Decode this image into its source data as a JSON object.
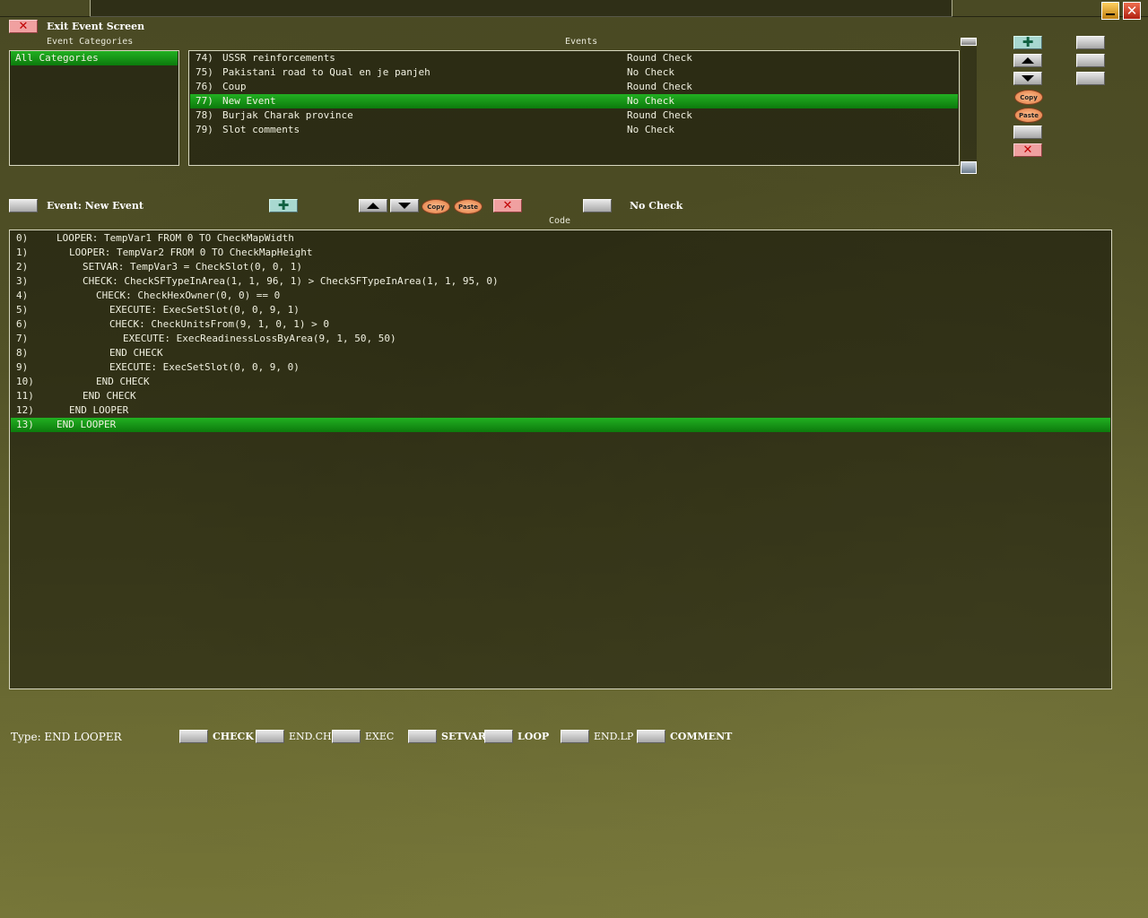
{
  "header": {
    "exit_label": "Exit Event Screen",
    "categories_title": "Event Categories",
    "events_title": "Events",
    "code_title": "Code"
  },
  "categories": [
    "All Categories"
  ],
  "events": [
    {
      "num": "74)",
      "name": "USSR reinforcements",
      "check": "Round Check"
    },
    {
      "num": "75)",
      "name": "Pakistani road to Qual en je panjeh",
      "check": "No Check"
    },
    {
      "num": "76)",
      "name": "Coup",
      "check": "Round Check"
    },
    {
      "num": "77)",
      "name": "New Event",
      "check": "No Check",
      "selected": true
    },
    {
      "num": "78)",
      "name": "Burjak Charak province",
      "check": "Round Check"
    },
    {
      "num": "79)",
      "name": "Slot comments",
      "check": "No Check"
    }
  ],
  "editor": {
    "event_label": "Event: New Event",
    "check_label": "No Check",
    "copy": "Copy",
    "paste": "Paste"
  },
  "code_lines": [
    {
      "n": "0)",
      "indent": 0,
      "text": "LOOPER: TempVar1 FROM 0 TO CheckMapWidth"
    },
    {
      "n": "1)",
      "indent": 1,
      "text": "LOOPER: TempVar2 FROM 0 TO CheckMapHeight"
    },
    {
      "n": "2)",
      "indent": 2,
      "text": "SETVAR: TempVar3 = CheckSlot(0, 0, 1)"
    },
    {
      "n": "3)",
      "indent": 2,
      "text": "CHECK: CheckSFTypeInArea(1, 1, 96, 1) > CheckSFTypeInArea(1, 1, 95, 0)"
    },
    {
      "n": "4)",
      "indent": 3,
      "text": "CHECK: CheckHexOwner(0, 0) == 0"
    },
    {
      "n": "5)",
      "indent": 4,
      "text": "EXECUTE: ExecSetSlot(0, 0, 9, 1)"
    },
    {
      "n": "6)",
      "indent": 4,
      "text": "CHECK: CheckUnitsFrom(9, 1, 0, 1) > 0"
    },
    {
      "n": "7)",
      "indent": 5,
      "text": "EXECUTE: ExecReadinessLossByArea(9, 1, 50, 50)"
    },
    {
      "n": "8)",
      "indent": 4,
      "text": "END CHECK"
    },
    {
      "n": "9)",
      "indent": 4,
      "text": "EXECUTE: ExecSetSlot(0, 0, 9, 0)"
    },
    {
      "n": "10)",
      "indent": 3,
      "text": "END CHECK"
    },
    {
      "n": "11)",
      "indent": 2,
      "text": "END CHECK"
    },
    {
      "n": "12)",
      "indent": 1,
      "text": "END LOOPER"
    },
    {
      "n": "13)",
      "indent": 0,
      "text": "END LOOPER",
      "selected": true
    }
  ],
  "type_bar": {
    "type_label": "Type: END LOOPER",
    "buttons": [
      "CHECK",
      "END.CH",
      "EXEC",
      "SETVAR",
      "LOOP",
      "END.LP",
      "COMMENT"
    ]
  },
  "colors": {
    "selection": "#18a018",
    "panel_border": "#d8d8c0",
    "delete": "#f0a0a0",
    "add": "#a8d8d0"
  }
}
